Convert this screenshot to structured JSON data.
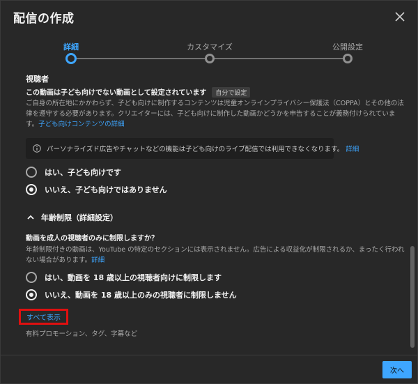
{
  "dialog": {
    "title": "配信の作成",
    "close_icon": "close-icon"
  },
  "stepper": {
    "steps": [
      {
        "label": "詳細",
        "state": "active"
      },
      {
        "label": "カスタマイズ",
        "state": "inactive"
      },
      {
        "label": "公開設定",
        "state": "inactive"
      }
    ]
  },
  "audience": {
    "heading": "視聴者",
    "setting_title": "この動画は子ども向けでない動画として設定されています",
    "setting_chip": "自分で設定",
    "description": "ご自身の所在地にかかわらず、子ども向けに制作するコンテンツは児童オンラインプライバシー保護法（COPPA）とその他の法律を遵守する必要があります。クリエイターには、子ども向けに制作した動画かどうかを申告することが義務付けられています。",
    "description_link": "子ども向けコンテンツの詳細",
    "info_text": "パーソナライズド広告やチャットなどの機能は子ども向けのライブ配信では利用できなくなります。",
    "info_link": "詳細",
    "options": [
      {
        "label": "はい、子ども向けです",
        "checked": false
      },
      {
        "label": "いいえ、子ども向けではありません",
        "checked": true
      }
    ]
  },
  "age_restriction": {
    "toggle_label": "年齢制限（詳細設定）",
    "question": "動画を成人の視聴者のみに制限しますか？",
    "description": "年齢制限付きの動画は、YouTube の特定のセクションには表示されません。広告による収益化が制限されるか、まったく行われない場合があります。",
    "description_link": "詳細",
    "options": [
      {
        "label": "はい、動画を 18 歳以上の視聴者向けに制限します",
        "checked": false
      },
      {
        "label": "いいえ、動画を 18 歳以上のみの視聴者に制限しません",
        "checked": true
      }
    ]
  },
  "show_all": {
    "label": "すべて表示",
    "subtext": "有料プロモーション、タグ、字幕など"
  },
  "footer": {
    "next_label": "次へ"
  },
  "colors": {
    "accent": "#3ea6ff",
    "highlight_border": "#e01010",
    "background": "#282828"
  }
}
